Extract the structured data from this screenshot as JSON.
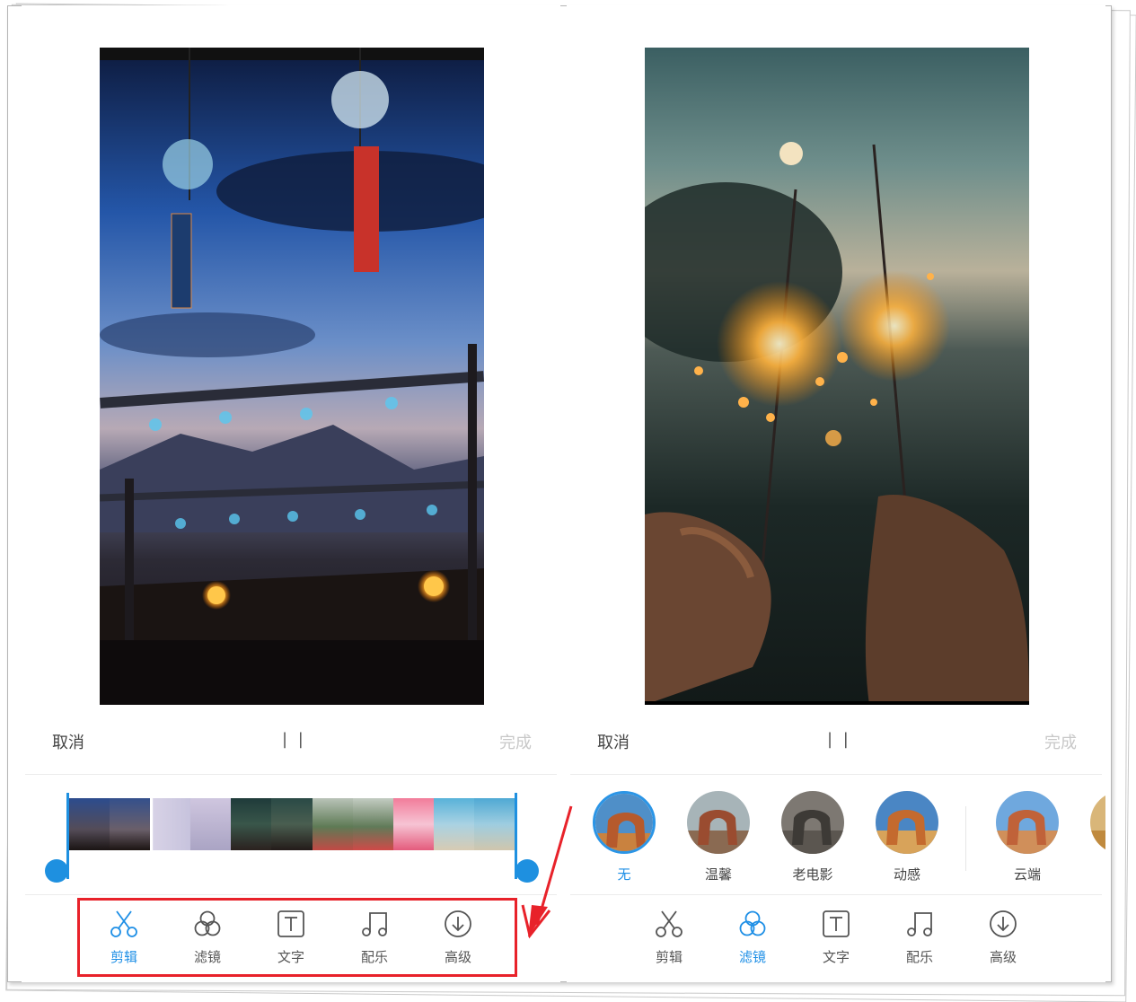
{
  "colors": {
    "accent": "#1e8fe6",
    "annotation": "#e8222a",
    "muted": "#c8c8c8"
  },
  "left_screen": {
    "cancel": "取消",
    "pause": "| |",
    "done": "完成",
    "tools": [
      {
        "icon": "scissors-icon",
        "label": "剪辑",
        "active": true
      },
      {
        "icon": "filter-circles-icon",
        "label": "滤镜",
        "active": false
      },
      {
        "icon": "text-t-icon",
        "label": "文字",
        "active": false
      },
      {
        "icon": "music-note-icon",
        "label": "配乐",
        "active": false
      },
      {
        "icon": "download-circle-icon",
        "label": "高级",
        "active": false
      }
    ]
  },
  "right_screen": {
    "cancel": "取消",
    "pause": "| |",
    "done": "完成",
    "filters": [
      {
        "label": "无",
        "selected": true
      },
      {
        "label": "温馨",
        "selected": false
      },
      {
        "label": "老电影",
        "selected": false
      },
      {
        "label": "动感",
        "selected": false
      },
      {
        "label": "云端",
        "selected": false
      }
    ],
    "tools": [
      {
        "icon": "scissors-icon",
        "label": "剪辑",
        "active": false
      },
      {
        "icon": "filter-circles-icon",
        "label": "滤镜",
        "active": true
      },
      {
        "icon": "text-t-icon",
        "label": "文字",
        "active": false
      },
      {
        "icon": "music-note-icon",
        "label": "配乐",
        "active": false
      },
      {
        "icon": "download-circle-icon",
        "label": "高级",
        "active": false
      }
    ]
  }
}
